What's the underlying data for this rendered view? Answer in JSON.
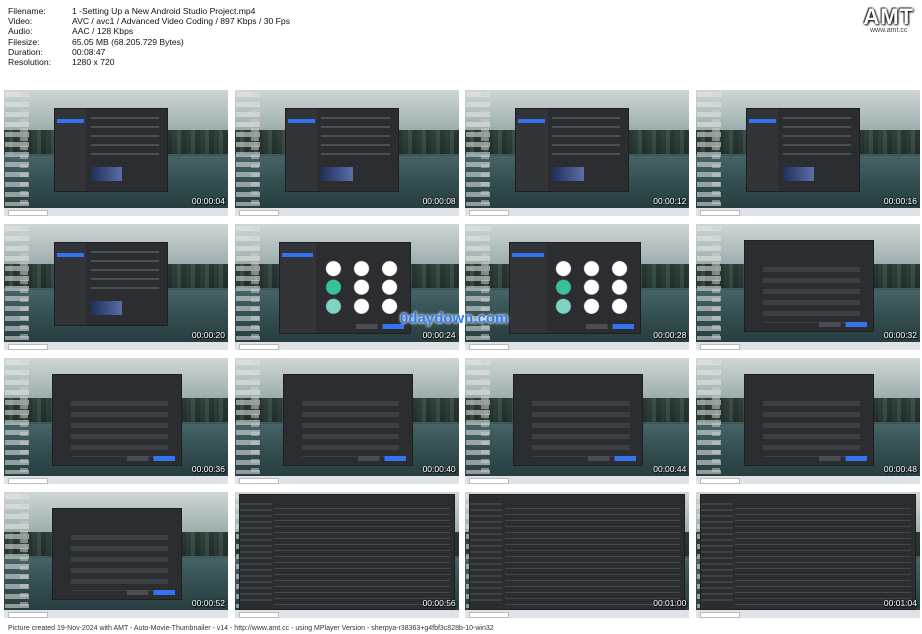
{
  "info": [
    {
      "key": "Filename:",
      "value": "1 -Setting Up a New Android Studio Project.mp4"
    },
    {
      "key": "Video:",
      "value": "AVC / avc1 / Advanced Video Coding / 897 Kbps / 30 Fps"
    },
    {
      "key": "Audio:",
      "value": "AAC / 128 Kbps"
    },
    {
      "key": "Filesize:",
      "value": "65.05 MB (68.205.729 Bytes)"
    },
    {
      "key": "Duration:",
      "value": "00:08:47"
    },
    {
      "key": "Resolution:",
      "value": "1280 x 720"
    }
  ],
  "logo": {
    "big": "AMT",
    "small": "www.amt.cc"
  },
  "thumbnails": [
    {
      "time": "00:00:04",
      "view": "welcome"
    },
    {
      "time": "00:00:08",
      "view": "welcome"
    },
    {
      "time": "00:00:12",
      "view": "welcome"
    },
    {
      "time": "00:00:16",
      "view": "welcome"
    },
    {
      "time": "00:00:20",
      "view": "welcome"
    },
    {
      "time": "00:00:24",
      "view": "templates"
    },
    {
      "time": "00:00:28",
      "view": "templates"
    },
    {
      "time": "00:00:32",
      "view": "form"
    },
    {
      "time": "00:00:36",
      "view": "form"
    },
    {
      "time": "00:00:40",
      "view": "form"
    },
    {
      "time": "00:00:44",
      "view": "form"
    },
    {
      "time": "00:00:48",
      "view": "form"
    },
    {
      "time": "00:00:52",
      "view": "form"
    },
    {
      "time": "00:00:56",
      "view": "ide"
    },
    {
      "time": "00:01:00",
      "view": "ide"
    },
    {
      "time": "00:01:04",
      "view": "ide"
    }
  ],
  "watermark": "0daydown.com",
  "footer": "Picture created 19-Nov-2024 with AMT - Auto-Movie-Thumbnailer - v14 - http://www.amt.cc - using MPlayer Version - sherpya-r38363+g4fbf3c828b-10-win32"
}
